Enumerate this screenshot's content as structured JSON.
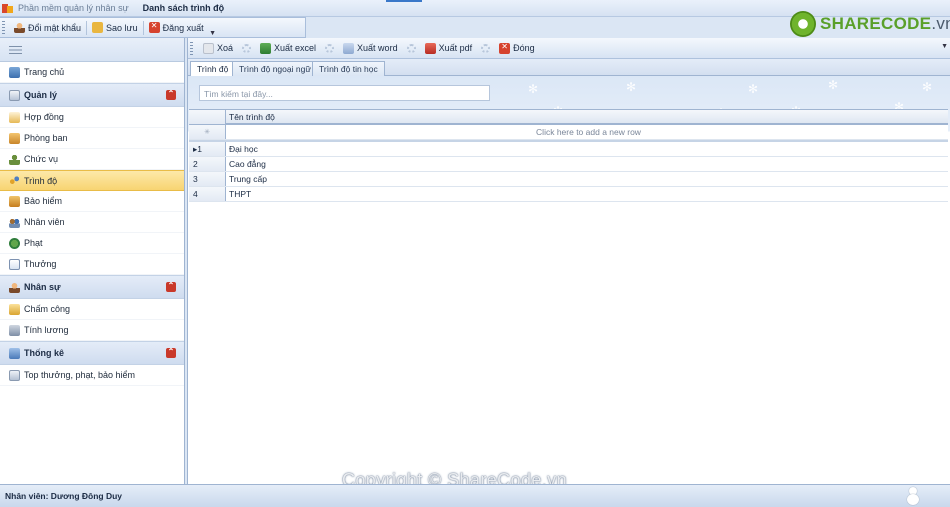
{
  "titlebar": {
    "app_title": "Phần mềm quản lý nhân sự",
    "window_title": "Danh sách trình độ"
  },
  "quick_toolbar": {
    "change_password": "Đổi mật khẩu",
    "backup": "Sao lưu",
    "logout": "Đăng xuất"
  },
  "logo": {
    "main": "SHARECODE",
    "suffix": ".vn"
  },
  "nav": {
    "home": "Trang chủ",
    "groups": [
      {
        "title": "Quản lý",
        "items": [
          "Hợp đồng",
          "Phòng ban",
          "Chức vụ",
          "Trình độ",
          "Bảo hiểm",
          "Nhân viên",
          "Phạt",
          "Thưởng"
        ]
      },
      {
        "title": "Nhân sự",
        "items": [
          "Chấm công",
          "Tính lương"
        ]
      },
      {
        "title": "Thống kê",
        "items": [
          "Top thưởng, phạt, bảo hiểm"
        ]
      }
    ],
    "active_item": "Trình độ"
  },
  "main_toolbar": {
    "delete": "Xoá",
    "export_excel": "Xuất excel",
    "export_word": "Xuất word",
    "export_pdf": "Xuất pdf",
    "close": "Đóng"
  },
  "tabs": [
    "Trình độ",
    "Trình độ ngoại ngữ",
    "Trình độ tin học"
  ],
  "active_tab": "Trình độ",
  "search": {
    "placeholder": "Tìm kiếm tại đây..."
  },
  "grid": {
    "column_header": "Tên trình độ",
    "new_row_hint": "Click here to add a new row",
    "rows": [
      {
        "index": "1",
        "name": "Đại học"
      },
      {
        "index": "2",
        "name": "Cao đẳng"
      },
      {
        "index": "3",
        "name": "Trung cấp"
      },
      {
        "index": "4",
        "name": "THPT"
      }
    ]
  },
  "watermark": "Copyright © ShareCode.vn",
  "status": {
    "employee": "Nhân viên: Dương Đông Duy"
  }
}
